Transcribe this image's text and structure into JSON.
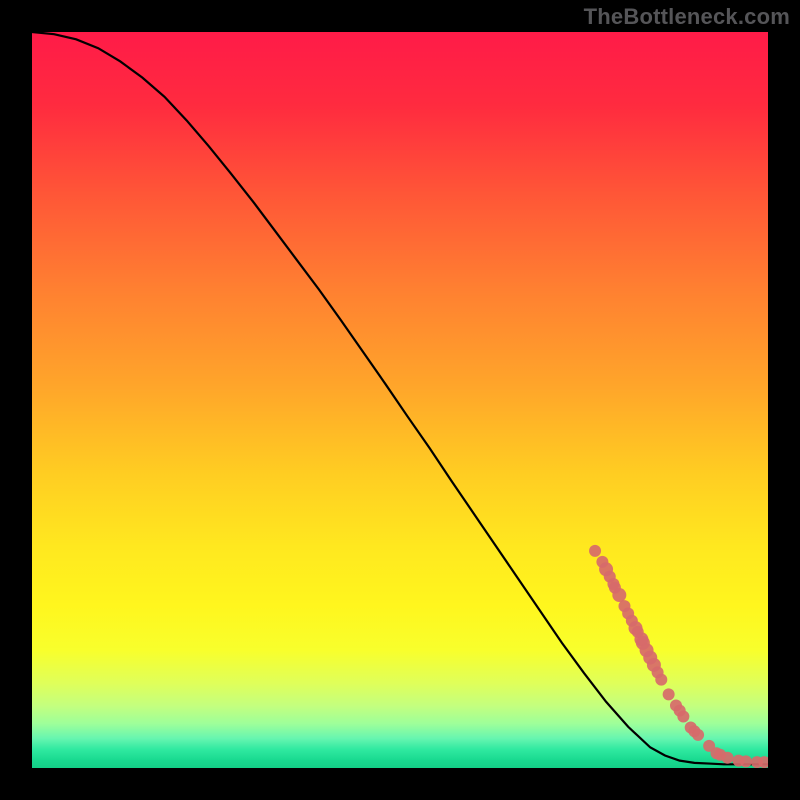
{
  "watermark": "TheBottleneck.com",
  "chart_data": {
    "type": "line",
    "title": "",
    "xlabel": "",
    "ylabel": "",
    "xlim": [
      0,
      100
    ],
    "ylim": [
      0,
      100
    ],
    "grid": false,
    "curve": {
      "name": "curve",
      "x": [
        0,
        3,
        6,
        9,
        12,
        15,
        18,
        21,
        24,
        27,
        30,
        33,
        36,
        39,
        42,
        45,
        48,
        51,
        54,
        57,
        60,
        63,
        66,
        69,
        72,
        75,
        78,
        81,
        84,
        86,
        88,
        90,
        92,
        94,
        96,
        98,
        100
      ],
      "y": [
        100,
        99.7,
        99.0,
        97.8,
        96.0,
        93.8,
        91.2,
        88.0,
        84.5,
        80.8,
        77.0,
        73.0,
        69.0,
        65.0,
        60.8,
        56.5,
        52.2,
        47.8,
        43.5,
        39.0,
        34.6,
        30.2,
        25.8,
        21.4,
        17.0,
        12.9,
        9.0,
        5.6,
        2.8,
        1.7,
        1.0,
        0.7,
        0.6,
        0.5,
        0.5,
        0.5,
        0.5
      ]
    },
    "series": [
      {
        "name": "scatter-pink",
        "color": "#d76a6a",
        "x": [
          76.5,
          77.5,
          78.0,
          78.5,
          79.0,
          79.2,
          79.8,
          80.5,
          81.0,
          81.5,
          82.0,
          82.3,
          82.8,
          83.0,
          83.5,
          84.0,
          84.5,
          85.0,
          85.5,
          86.5,
          87.5,
          88.0,
          88.5,
          89.5,
          90.0,
          90.5,
          92.0,
          93.0,
          93.5,
          94.5,
          96.0,
          97.0,
          98.5,
          99.5
        ],
        "y": [
          29.5,
          28.0,
          27.0,
          26.0,
          25.0,
          24.5,
          23.5,
          22.0,
          21.0,
          20.0,
          19.0,
          18.5,
          17.5,
          17.0,
          16.0,
          15.0,
          14.0,
          13.0,
          12.0,
          10.0,
          8.5,
          7.8,
          7.0,
          5.5,
          5.0,
          4.5,
          3.0,
          2.0,
          1.8,
          1.4,
          1.0,
          0.9,
          0.8,
          0.8
        ],
        "r": [
          6,
          6,
          7,
          6,
          6,
          6,
          7,
          6,
          6,
          6,
          7,
          6,
          7,
          7,
          7,
          7,
          7,
          6,
          6,
          6,
          6,
          6,
          6,
          6,
          6,
          6,
          6,
          6,
          6,
          6,
          6,
          6,
          6,
          6
        ]
      }
    ],
    "gradient_stops": [
      {
        "offset": 0.0,
        "color": "#ff1b48"
      },
      {
        "offset": 0.1,
        "color": "#ff2b3f"
      },
      {
        "offset": 0.22,
        "color": "#ff5637"
      },
      {
        "offset": 0.35,
        "color": "#ff8031"
      },
      {
        "offset": 0.48,
        "color": "#ffa52a"
      },
      {
        "offset": 0.6,
        "color": "#ffcd22"
      },
      {
        "offset": 0.7,
        "color": "#ffe81f"
      },
      {
        "offset": 0.78,
        "color": "#fff61e"
      },
      {
        "offset": 0.84,
        "color": "#f8ff2c"
      },
      {
        "offset": 0.885,
        "color": "#dfff5a"
      },
      {
        "offset": 0.915,
        "color": "#c4ff7e"
      },
      {
        "offset": 0.94,
        "color": "#9dff9a"
      },
      {
        "offset": 0.96,
        "color": "#66f5b0"
      },
      {
        "offset": 0.975,
        "color": "#2fe9a0"
      },
      {
        "offset": 0.99,
        "color": "#18d98f"
      },
      {
        "offset": 1.0,
        "color": "#14cf87"
      }
    ]
  }
}
